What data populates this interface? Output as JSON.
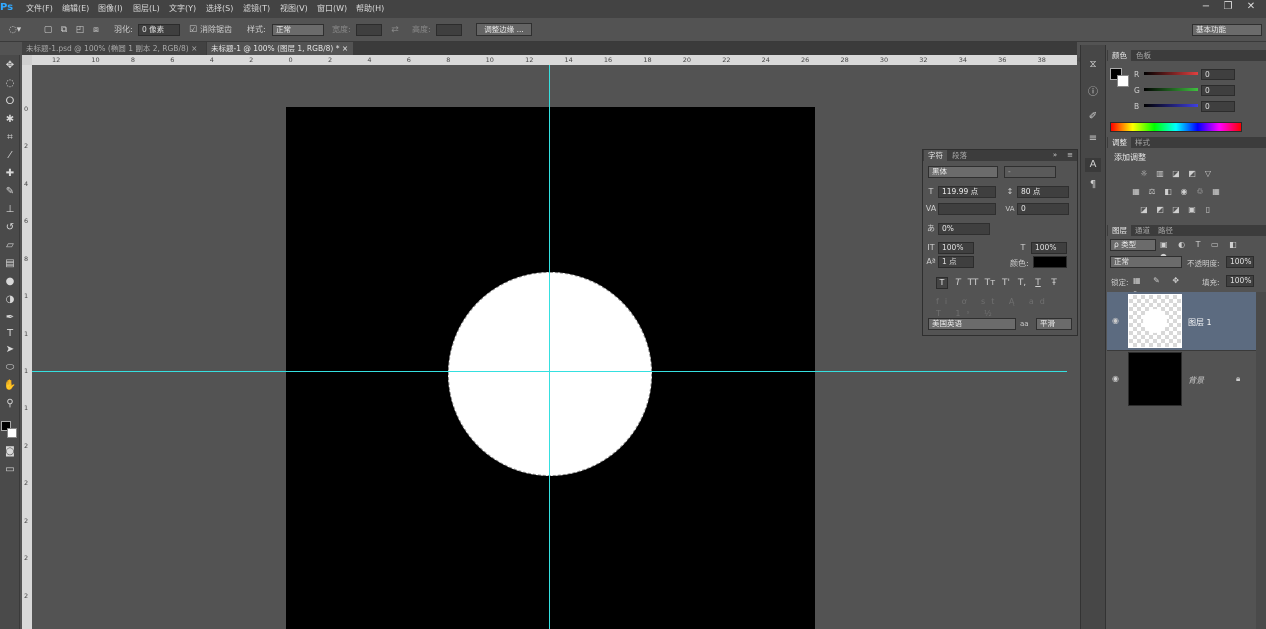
{
  "menu": {
    "logo": "Ps",
    "items": [
      "文件(F)",
      "编辑(E)",
      "图像(I)",
      "图层(L)",
      "文字(Y)",
      "选择(S)",
      "滤镜(T)",
      "视图(V)",
      "窗口(W)",
      "帮助(H)"
    ]
  },
  "window_controls": {
    "minimize": "−",
    "restore": "❐",
    "close": "✕"
  },
  "options": {
    "feather_label": "羽化:",
    "feather_value": "0 像素",
    "antialias_label": "消除锯齿",
    "style_label": "样式:",
    "style_value": "正常",
    "width_label": "宽度:",
    "height_label": "高度:",
    "refine_edge": "调整边缘 ...",
    "workspace": "基本功能"
  },
  "tabs": [
    {
      "label": "未标题-1.psd @ 100% (椭圆 1 副本 2, RGB/8)",
      "close": "×"
    },
    {
      "label": "未标题-1 @ 100% (图层 1, RGB/8) *",
      "close": "×"
    }
  ],
  "ruler": {
    "h_ticks": [
      "12",
      "10",
      "8",
      "6",
      "4",
      "2",
      "0",
      "2",
      "4",
      "6",
      "8",
      "10",
      "12",
      "14",
      "16",
      "18",
      "20",
      "22",
      "24",
      "26",
      "28",
      "30",
      "32",
      "34",
      "36",
      "38",
      "40"
    ],
    "v_ticks": [
      "0",
      "2",
      "4",
      "6",
      "8",
      "1",
      "1",
      "1",
      "1",
      "2",
      "2",
      "2",
      "2",
      "2",
      "3"
    ]
  },
  "character_panel": {
    "tab_character": "字符",
    "tab_paragraph": "段落",
    "font_family": "黑体",
    "font_style": "-",
    "font_size": "119.99 点",
    "leading": "80 点",
    "kerning": "",
    "tracking": "0",
    "scale_percent": "0%",
    "vertical_scale": "100%",
    "horizontal_scale": "100%",
    "baseline_shift": "1 点",
    "color_label": "颜色:",
    "language": "美国英语",
    "aa_label": "aa",
    "antialias": "平滑",
    "style_buttons": [
      "T",
      "T",
      "TT",
      "Tт",
      "T'",
      "T,",
      "T",
      "Ŧ"
    ]
  },
  "color_panel": {
    "tab_color": "颜色",
    "tab_swatches": "色板",
    "channels": [
      {
        "label": "R",
        "value": "0",
        "color": "#e04040"
      },
      {
        "label": "G",
        "value": "0",
        "color": "#40c040"
      },
      {
        "label": "B",
        "value": "0",
        "color": "#4040e0"
      }
    ]
  },
  "adjustments_panel": {
    "tab_adjust": "调整",
    "tab_styles": "样式",
    "title": "添加调整"
  },
  "layers_panel": {
    "tab_layers": "图层",
    "tab_channels": "通道",
    "tab_paths": "路径",
    "filter_kind": "ρ 类型",
    "blend_mode": "正常",
    "opacity_label": "不透明度:",
    "opacity": "100%",
    "lock_label": "锁定:",
    "fill_label": "填充:",
    "fill": "100%",
    "layers": [
      {
        "name": "图层 1",
        "selected": true
      },
      {
        "name": "背景",
        "selected": false
      }
    ]
  }
}
